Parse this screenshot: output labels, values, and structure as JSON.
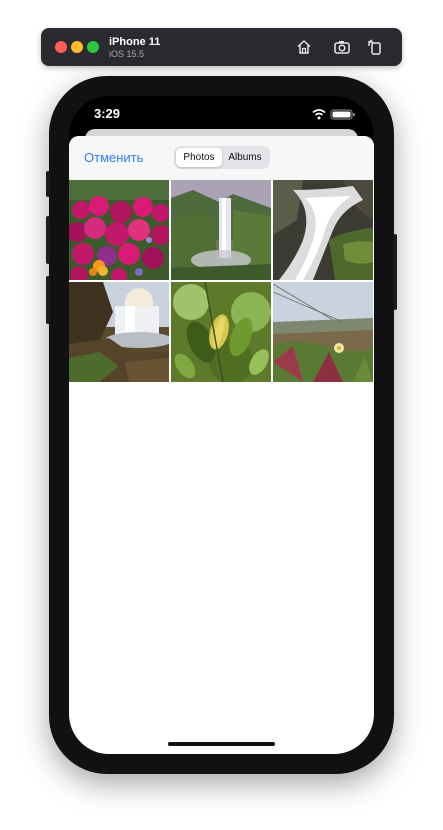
{
  "simulator": {
    "device_name": "iPhone 11",
    "os_version": "iOS 15.5",
    "toolbar_icons": [
      "home-icon",
      "screenshot-icon",
      "rotate-icon"
    ]
  },
  "status_bar": {
    "time": "3:29",
    "icons": [
      "wifi-icon",
      "battery-icon"
    ]
  },
  "picker": {
    "cancel_label": "Отменить",
    "segments": [
      {
        "label": "Photos",
        "selected": true
      },
      {
        "label": "Albums",
        "selected": false
      }
    ],
    "accent_color": "#2f7ef6",
    "photos": [
      {
        "subject": "pink-flowers-photo"
      },
      {
        "subject": "waterfall-valley-photo"
      },
      {
        "subject": "rushing-waterfall-photo"
      },
      {
        "subject": "waterfall-sunset-photo"
      },
      {
        "subject": "green-leaves-photo"
      },
      {
        "subject": "beach-flower-photo"
      }
    ]
  }
}
